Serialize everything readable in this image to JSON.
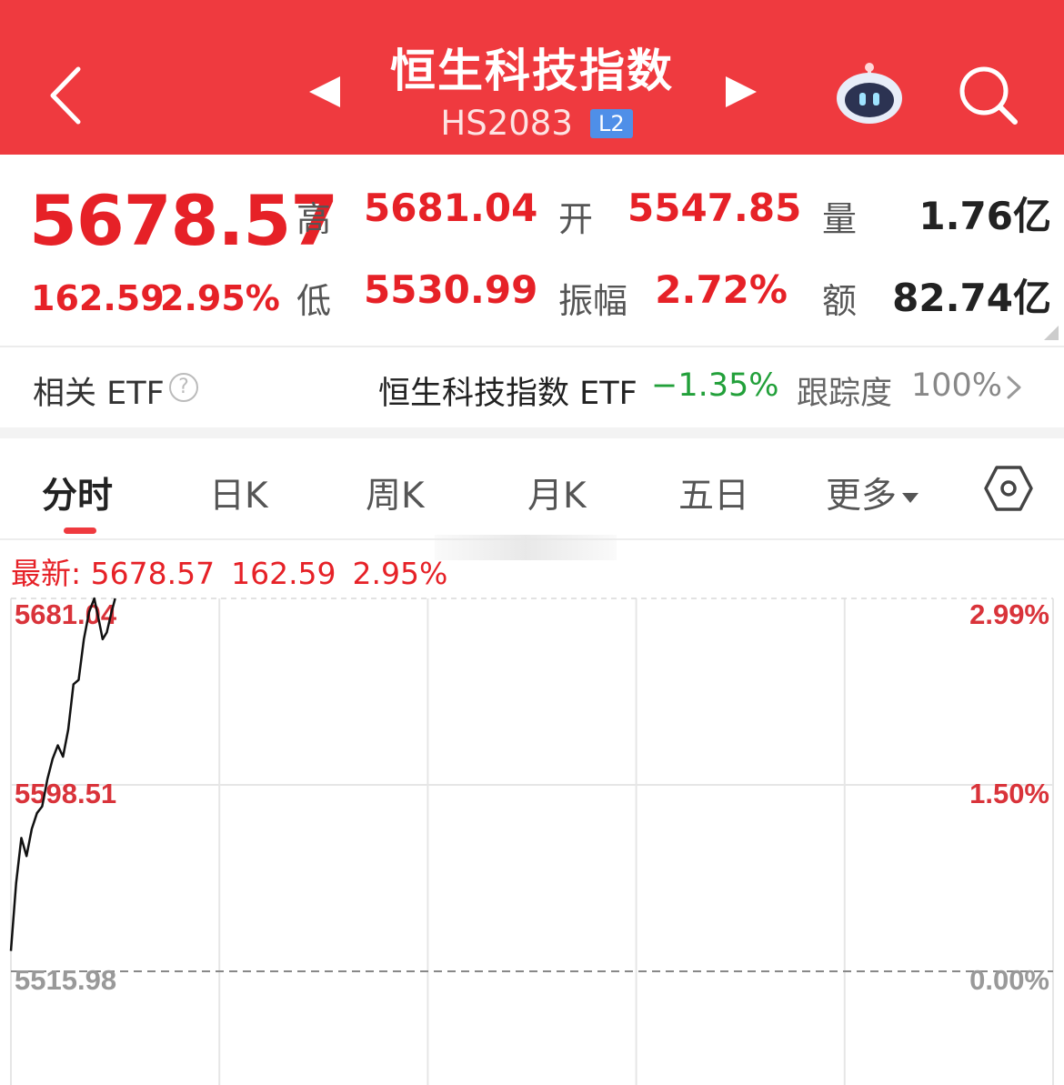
{
  "header": {
    "title": "恒生科技指数",
    "code": "HS2083",
    "level_badge": "L2",
    "icons": [
      "back-icon",
      "prev-arrow-icon",
      "next-arrow-icon",
      "robot-assistant-icon",
      "search-icon"
    ]
  },
  "quote": {
    "price": "5678.57",
    "change": "162.59",
    "change_pct": "2.95%",
    "high_label": "高",
    "high": "5681.04",
    "open_label": "开",
    "open": "5547.85",
    "volume_label": "量",
    "volume": "1.76亿",
    "low_label": "低",
    "low": "5530.99",
    "amplitude_label": "振幅",
    "amplitude": "2.72%",
    "turnover_label": "额",
    "turnover": "82.74亿"
  },
  "etf": {
    "label": "相关 ETF",
    "help": "?",
    "name": "恒生科技指数 ETF",
    "change_pct": "−1.35%",
    "tracking_label": "跟踪度",
    "tracking_value": "100%"
  },
  "tabs": {
    "items": [
      "分时",
      "日K",
      "周K",
      "月K",
      "五日",
      "更多"
    ],
    "active": "分时"
  },
  "latest": {
    "label": "最新: 5678.57",
    "change": "162.59",
    "pct": "2.95%"
  },
  "colors": {
    "brand_red": "#ef3a3f",
    "up_red": "#e62127",
    "down_green": "#22a03a",
    "badge_blue": "#4f8fe8"
  },
  "chart_data": {
    "type": "line",
    "y_left_labels": [
      "5681.04",
      "5598.51",
      "5515.98"
    ],
    "y_right_labels": [
      "2.99%",
      "1.50%",
      "0.00%"
    ],
    "ylim": [
      5515.98,
      5681.04
    ],
    "x_range": [
      0,
      100
    ],
    "series": [
      {
        "x": [
          0,
          0.5,
          1.0,
          1.5,
          2.0,
          2.5,
          3.0,
          3.5,
          4.0,
          4.5,
          5.0,
          5.5,
          6.0,
          6.5,
          7.0,
          7.5,
          8.0,
          8.5,
          8.8,
          9.2,
          9.6,
          10.0
        ],
        "y": [
          5525,
          5555,
          5575,
          5567,
          5579,
          5586,
          5589,
          5601,
          5610,
          5616,
          5611,
          5623,
          5643,
          5645,
          5663,
          5675,
          5681,
          5670,
          5663,
          5666,
          5674,
          5681
        ]
      }
    ]
  }
}
